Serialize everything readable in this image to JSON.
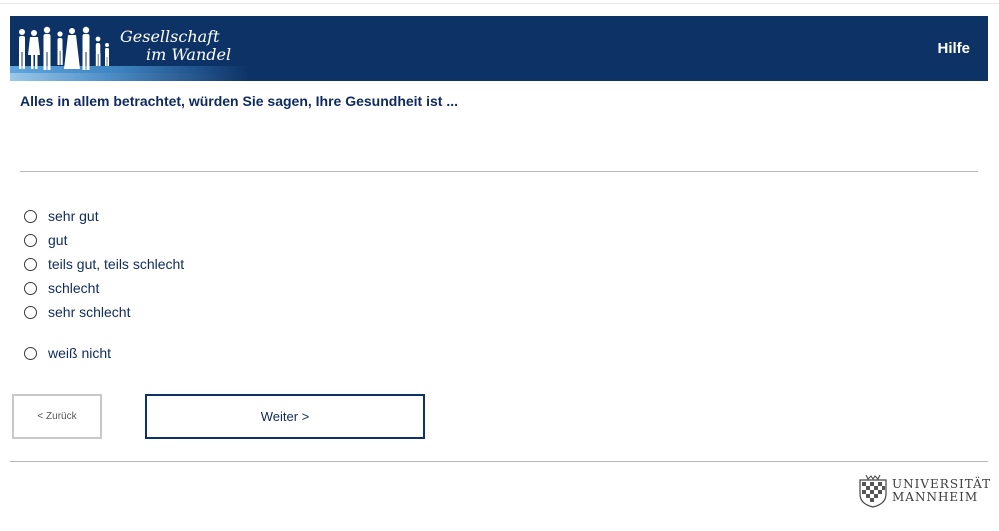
{
  "header": {
    "logo": {
      "line1": "Gesellschaft",
      "line2": "im Wandel"
    },
    "help_label": "Hilfe",
    "bg_color": "#0d3266"
  },
  "question": {
    "text": "Alles in allem betrachtet, würden Sie sagen, Ihre Gesundheit ist ..."
  },
  "options": [
    {
      "label": "sehr gut",
      "selected": false
    },
    {
      "label": "gut",
      "selected": false
    },
    {
      "label": "teils gut, teils schlecht",
      "selected": false
    },
    {
      "label": "schlecht",
      "selected": false
    },
    {
      "label": "sehr schlecht",
      "selected": false
    },
    {
      "label": "weiß nicht",
      "selected": false
    }
  ],
  "nav": {
    "back_label": "< Zurück",
    "next_label": "Weiter >"
  },
  "footer": {
    "university_line1": "UNIVERSITÄT",
    "university_line2": "MANNHEIM"
  }
}
